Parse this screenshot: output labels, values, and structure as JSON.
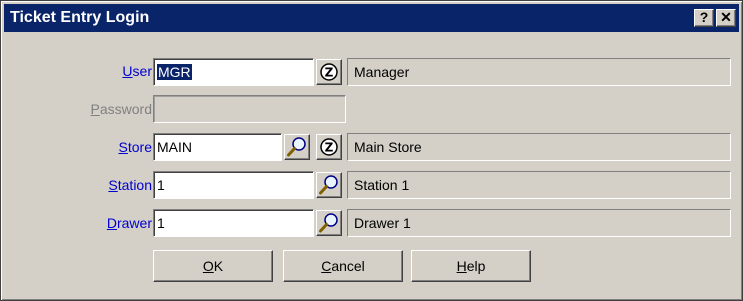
{
  "window": {
    "title": "Ticket Entry Login",
    "help_button": "?",
    "close_button": "✕"
  },
  "fields": {
    "user": {
      "label_key": "U",
      "label_rest": "ser",
      "value": "MGR",
      "description": "Manager"
    },
    "password": {
      "label_key": "P",
      "label_rest": "assword",
      "value": ""
    },
    "store": {
      "label_key": "S",
      "label_rest": "tore",
      "value": "MAIN",
      "description": "Main Store"
    },
    "station": {
      "label_key": "S",
      "label_rest": "tation",
      "value": "1",
      "description": "Station 1"
    },
    "drawer": {
      "label_key": "D",
      "label_rest": "rawer",
      "value": "1",
      "description": "Drawer 1"
    }
  },
  "buttons": {
    "ok": {
      "key": "O",
      "rest": "K"
    },
    "cancel": {
      "key": "C",
      "rest": "ancel"
    },
    "help": {
      "key": "H",
      "rest": "elp"
    }
  },
  "icons": {
    "lookup": "magnifier-icon",
    "zoom": "z-circle-icon"
  },
  "colors": {
    "title_bar": "#0a246a",
    "label_link": "#0000d0",
    "face": "#d4d0c8"
  }
}
